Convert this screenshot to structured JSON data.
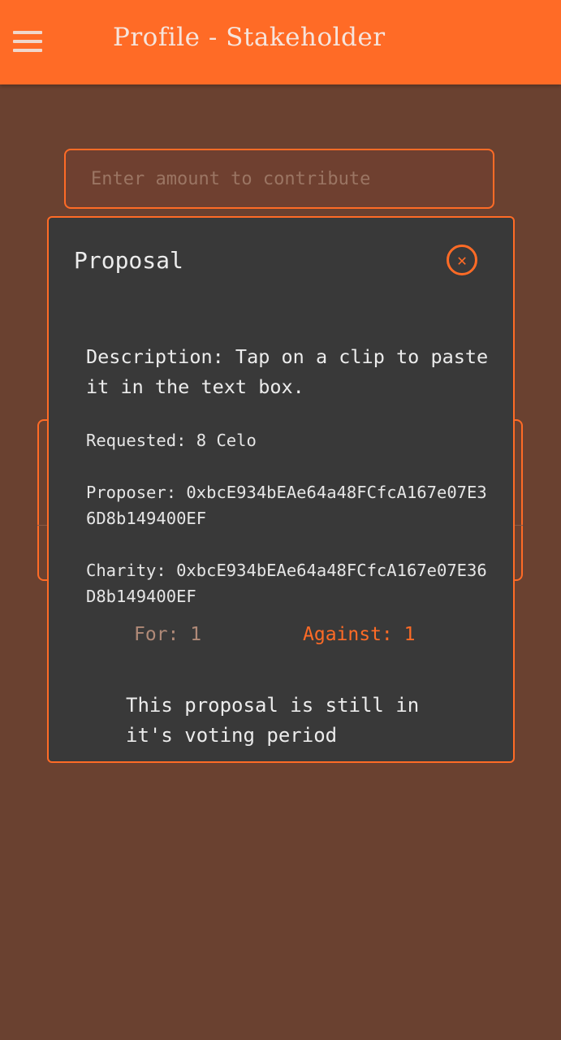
{
  "app_bar": {
    "title": "Profile - Stakeholder",
    "menu_icon": "hamburger-menu-icon",
    "color": "#ff6b26"
  },
  "contribute": {
    "placeholder": "Enter amount to contribute",
    "value": ""
  },
  "dialog": {
    "title": "Proposal",
    "close_icon": "close-circle-icon",
    "description": "Description: Tap on a clip to paste it in the text box.",
    "requested": "Requested: 8 Celo",
    "proposer": "Proposer: 0xbcE934bEAe64a48FCfcA167e07E36D8b149400EF",
    "charity": "Charity: 0xbcE934bEAe64a48FCfcA167e07E36D8b149400EF",
    "votes_for": "For: 1",
    "votes_against": "Against: 1",
    "status": "This proposal is still in it's voting period"
  },
  "colors": {
    "accent": "#ff6b26",
    "background": "#6a4130",
    "dialog_bg": "#393939"
  }
}
